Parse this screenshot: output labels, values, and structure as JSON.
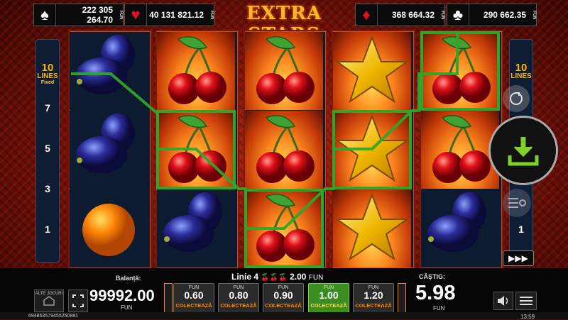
{
  "title": "EXTRA STARS",
  "jackpots": [
    {
      "suit": "spade-icon",
      "glyph": "♠",
      "color": "#ffffff",
      "value": "222 305 264.70",
      "currency": "FUN"
    },
    {
      "suit": "heart-icon",
      "glyph": "♥",
      "color": "#e0121b",
      "value": "40 131 821.12",
      "currency": "FUN"
    },
    {
      "suit": "diamond-icon",
      "glyph": "♦",
      "color": "#e0121b",
      "value": "368 664.32",
      "currency": "FUN"
    },
    {
      "suit": "club-icon",
      "glyph": "♣",
      "color": "#ffffff",
      "value": "290 662.35",
      "currency": "FUN"
    }
  ],
  "line_panel": {
    "count": "10",
    "label": "LINES",
    "sub": "Fixed",
    "numbers": [
      "7",
      "5",
      "3",
      "1"
    ],
    "right_last": "1"
  },
  "reels": [
    [
      "plum",
      "plum",
      "orange"
    ],
    [
      "cherry",
      "cherry",
      "plum"
    ],
    [
      "cherry",
      "cherry",
      "cherry"
    ],
    [
      "star",
      "star",
      "star"
    ],
    [
      "cherry",
      "cherry",
      "plum"
    ]
  ],
  "win_line": {
    "line": "Linie 4",
    "amount": "2.00",
    "currency": "FUN"
  },
  "balance": {
    "label": "Balanță:",
    "value": "99992.00",
    "currency": "FUN"
  },
  "bets": [
    {
      "top": "FUN",
      "value": "0.60",
      "action": "COLECTEAZĂ",
      "selected": false
    },
    {
      "top": "FUN",
      "value": "0.80",
      "action": "COLECTEAZĂ",
      "selected": false
    },
    {
      "top": "FUN",
      "value": "0.90",
      "action": "COLECTEAZĂ",
      "selected": false
    },
    {
      "top": "FUN",
      "value": "1.00",
      "action": "COLECTEAZĂ",
      "selected": true
    },
    {
      "top": "FUN",
      "value": "1.20",
      "action": "COLECTEAZĂ",
      "selected": false
    }
  ],
  "win": {
    "label": "CÂȘTIG:",
    "value": "5.98",
    "currency": "FUN"
  },
  "other_games": "ALTE JOCURI",
  "ticket_id": "694863579455250881",
  "clock": "13:59",
  "autoplay": "▶▶▶"
}
